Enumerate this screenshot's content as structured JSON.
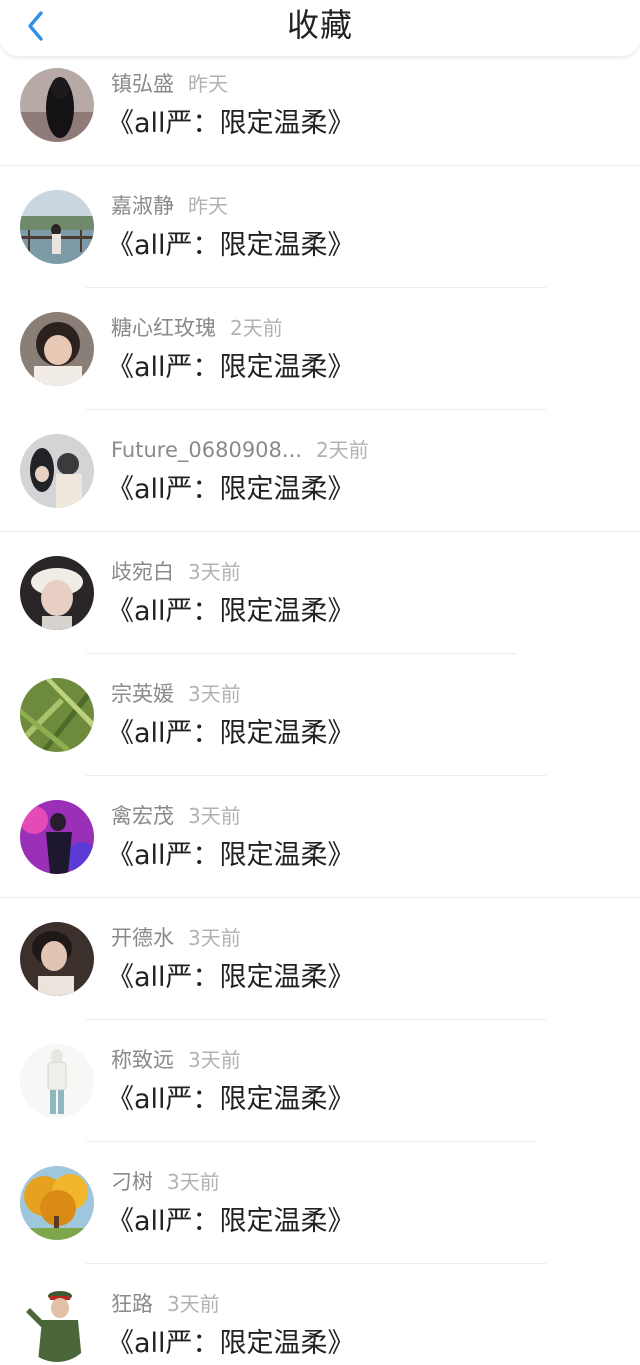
{
  "header": {
    "title": "收藏",
    "back_icon": "chevron-left-icon",
    "accent_color": "#2f8fea"
  },
  "favorites": [
    {
      "name": "镇弘盛",
      "time": "昨天",
      "book": "《all严：限定温柔》",
      "avatar": "dark-hair-portrait"
    },
    {
      "name": "嘉淑静",
      "time": "昨天",
      "book": "《all严：限定温柔》",
      "avatar": "lake-scenery-photo"
    },
    {
      "name": "糖心红玫瑰",
      "time": "2天前",
      "book": "《all严：限定温柔》",
      "avatar": "boy-portrait"
    },
    {
      "name": "Future_0680908...",
      "time": "2天前",
      "book": "《all严：限定温柔》",
      "avatar": "couple-photo"
    },
    {
      "name": "歧宛白",
      "time": "3天前",
      "book": "《all严：限定温柔》",
      "avatar": "child-with-hat"
    },
    {
      "name": "宗英媛",
      "time": "3天前",
      "book": "《all严：限定温柔》",
      "avatar": "green-plants"
    },
    {
      "name": "禽宏茂",
      "time": "3天前",
      "book": "《all严：限定温柔》",
      "avatar": "stage-performer"
    },
    {
      "name": "开德水",
      "time": "3天前",
      "book": "《all严：限定温柔》",
      "avatar": "young-man-portrait"
    },
    {
      "name": "称致远",
      "time": "3天前",
      "book": "《all严：限定温柔》",
      "avatar": "standing-figure"
    },
    {
      "name": "刁树",
      "time": "3天前",
      "book": "《all严：限定温柔》",
      "avatar": "autumn-tree"
    },
    {
      "name": "狂路",
      "time": "3天前",
      "book": "《all严：限定温柔》",
      "avatar": "uniform-officer"
    }
  ]
}
